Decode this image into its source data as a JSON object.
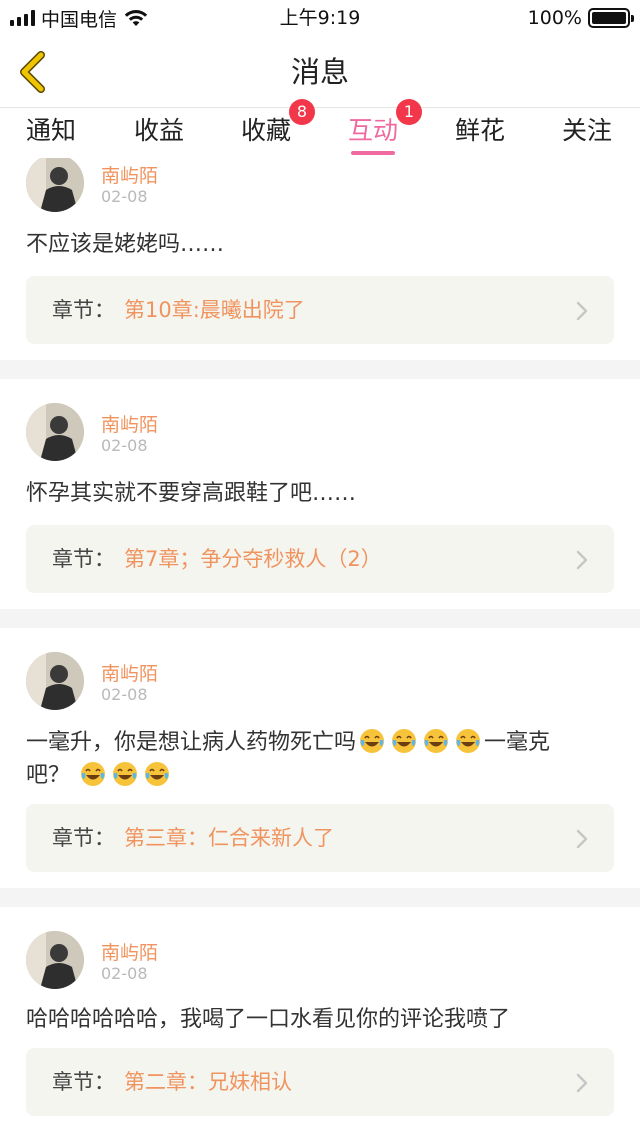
{
  "status_bar": {
    "carrier": "中国电信",
    "time": "上午9:19",
    "battery": "100%",
    "battery_level": 1.0
  },
  "nav": {
    "title": "消息",
    "back_icon": "chevron-left-icon",
    "back_color": "#f0c400"
  },
  "tabs": [
    {
      "label": "通知"
    },
    {
      "label": "收益"
    },
    {
      "label": "收藏",
      "badge": "8"
    },
    {
      "label": "互动",
      "badge": "1",
      "active": true
    },
    {
      "label": "鲜花"
    },
    {
      "label": "关注"
    }
  ],
  "colors": {
    "accent_pink": "#ef6aa0",
    "badge_red": "#f3374a",
    "name_orange": "#f0945f"
  },
  "chapter_label": "章节：",
  "messages": [
    {
      "user": "南屿陌",
      "date": "02-08",
      "comment": "不应该是姥姥吗……",
      "chapter": "第10章:晨曦出院了"
    },
    {
      "user": "南屿陌",
      "date": "02-08",
      "comment": "怀孕其实就不要穿高跟鞋了吧……",
      "chapter": "第7章；争分夺秒救人（2）"
    },
    {
      "user": "南屿陌",
      "date": "02-08",
      "comment_part1": "一毫升，你是想让病人药物死亡吗",
      "comment_part2": "一毫克",
      "comment_part3": "吧？",
      "emoji_icon": "tears-of-joy-emoji-icon",
      "chapter": "第三章：仁合来新人了"
    },
    {
      "user": "南屿陌",
      "date": "02-08",
      "comment": "哈哈哈哈哈哈，我喝了一口水看见你的评论我喷了",
      "chapter": "第二章：兄妹相认"
    }
  ]
}
